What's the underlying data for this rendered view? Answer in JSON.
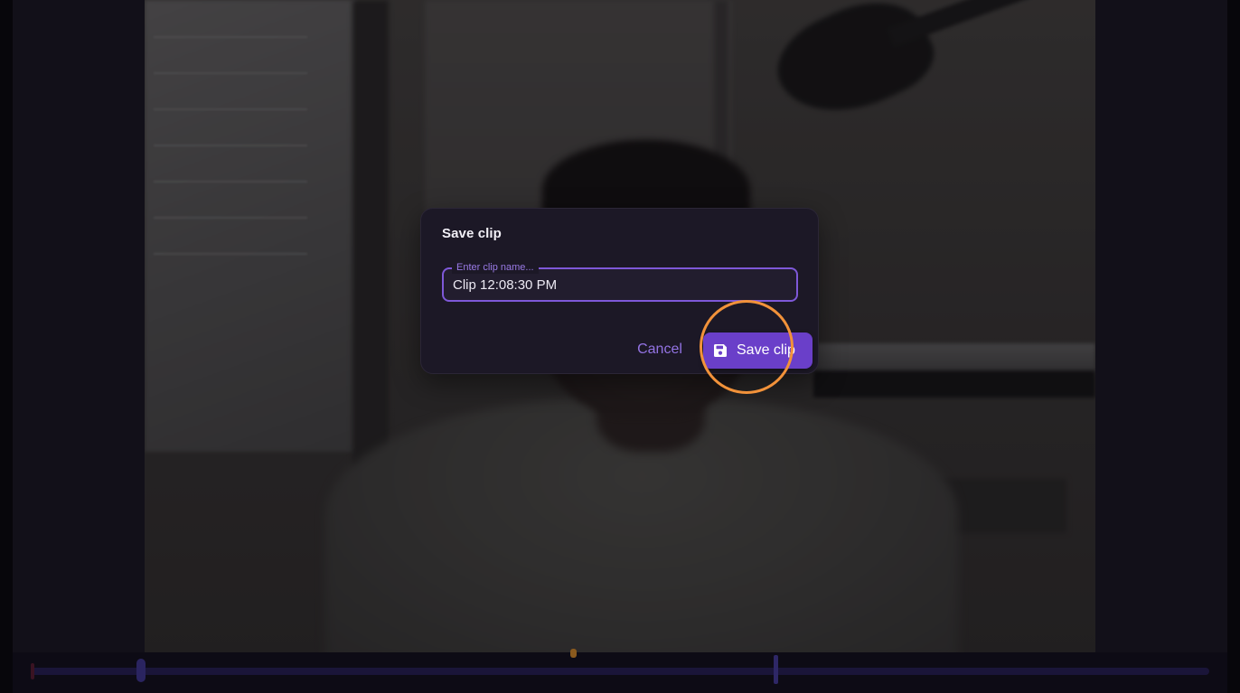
{
  "dialog": {
    "title": "Save clip",
    "input_label": "Enter clip name...",
    "input_value": "Clip 12:08:30 PM",
    "cancel_label": "Cancel",
    "save_label": "Save clip",
    "save_icon": "floppy-disk-icon"
  },
  "colors": {
    "accent": "#6a3fc9",
    "accent_text": "#9373e3",
    "dialog_bg": "#1c1826",
    "click_highlight": "#f2923a"
  }
}
